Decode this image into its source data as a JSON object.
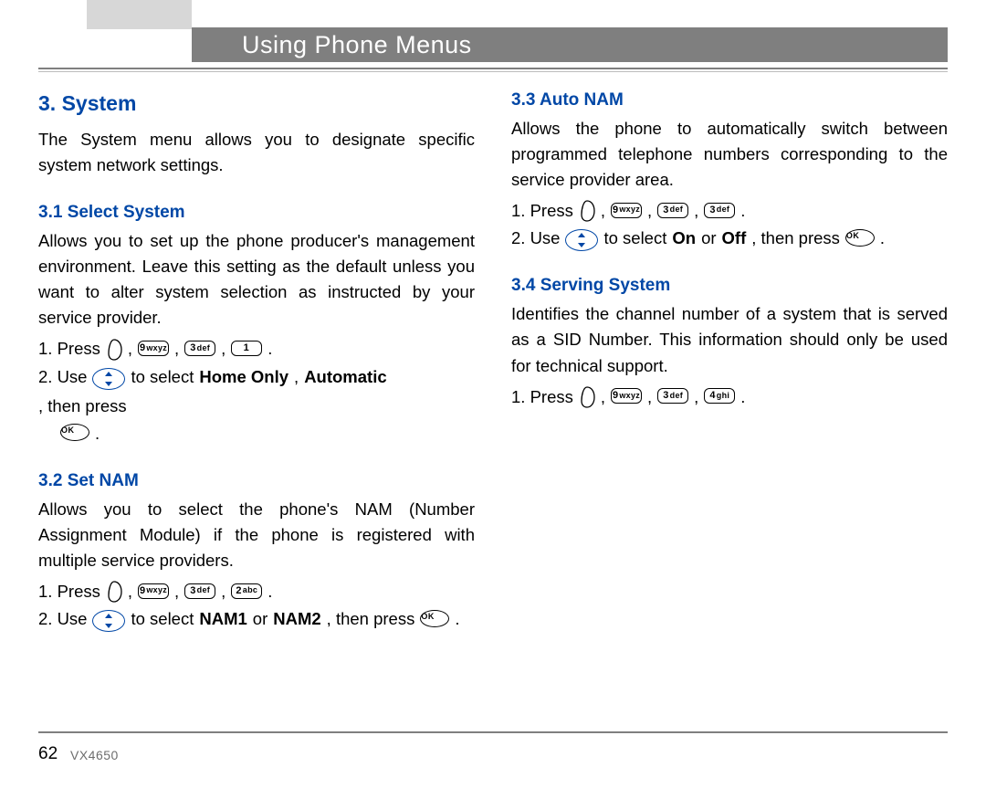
{
  "header": {
    "title": "Using Phone Menus"
  },
  "page_number": "62",
  "model": "VX4650",
  "keys": {
    "k1": {
      "digit": "1",
      "letters": ""
    },
    "k2": {
      "digit": "2",
      "letters": "abc"
    },
    "k3": {
      "digit": "3",
      "letters": "def"
    },
    "k4": {
      "digit": "4",
      "letters": "ghi"
    },
    "k9": {
      "digit": "9",
      "letters": "wxyz"
    },
    "ok": "OK"
  },
  "left": {
    "h2": "3. System",
    "intro": "The System menu allows you to designate specific system network settings.",
    "s31": {
      "h": "3.1 Select System",
      "body": "Allows you to set up the phone producer's management environment. Leave this setting as the default unless you want to alter system selection as instructed by your service provider.",
      "step1_a": "1.  Press",
      "step2_a": "2.  Use",
      "step2_b": " to select ",
      "step2_opt1": "Home Only",
      "step2_sep": ", ",
      "step2_opt2": "Automatic",
      "step2_c": ", then press"
    },
    "s32": {
      "h": "3.2 Set NAM",
      "body": "Allows you to select the phone's NAM (Number Assignment Module) if the phone is registered with multiple service providers.",
      "step1_a": "1.  Press",
      "step2_a": "2.  Use",
      "step2_b": " to select ",
      "step2_opt1": "NAM1",
      "step2_or": " or ",
      "step2_opt2": "NAM2",
      "step2_c": ", then press"
    }
  },
  "right": {
    "s33": {
      "h": "3.3 Auto NAM",
      "body": "Allows the phone to automatically switch between programmed telephone numbers corresponding to the service provider area.",
      "step1_a": "1.  Press",
      "step2_a": "2.  Use",
      "step2_b": " to select ",
      "step2_opt1": "On",
      "step2_or": " or ",
      "step2_opt2": "Off",
      "step2_c": ", then press"
    },
    "s34": {
      "h": "3.4 Serving System",
      "body": "Identifies the channel number of a system that is served as a SID Number. This information should only be used for technical support.",
      "step1_a": "1.   Press"
    }
  }
}
